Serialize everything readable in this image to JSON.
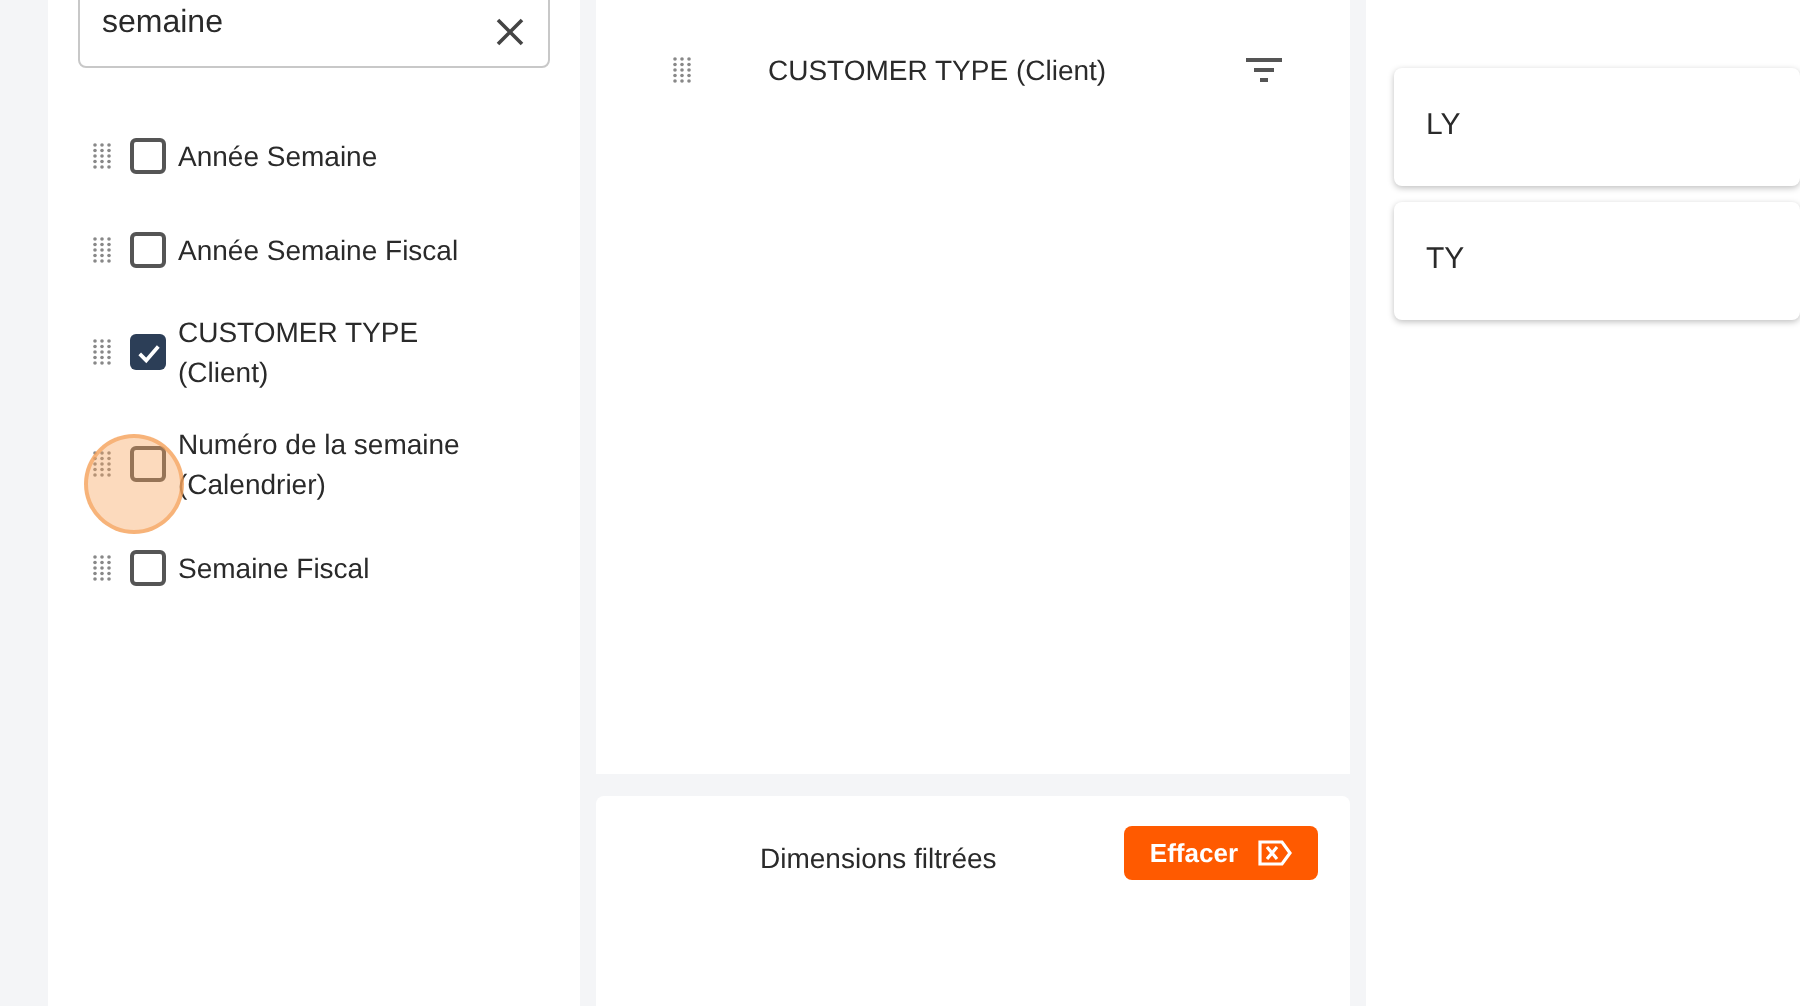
{
  "search": {
    "value": "semaine"
  },
  "fields": [
    {
      "label": "Année Semaine",
      "checked": false
    },
    {
      "label": "Année Semaine Fiscal",
      "checked": false
    },
    {
      "label": "CUSTOMER TYPE (Client)",
      "checked": true
    },
    {
      "label": "Numéro de la semaine (Calendrier)",
      "checked": false
    },
    {
      "label": "Semaine Fiscal",
      "checked": false
    }
  ],
  "selected_dimensions": [
    {
      "label": "CUSTOMER TYPE (Client)"
    }
  ],
  "filtered": {
    "title": "Dimensions filtrées",
    "clear_button": "Effacer"
  },
  "measures": [
    {
      "label": "LY"
    },
    {
      "label": "TY"
    }
  ]
}
